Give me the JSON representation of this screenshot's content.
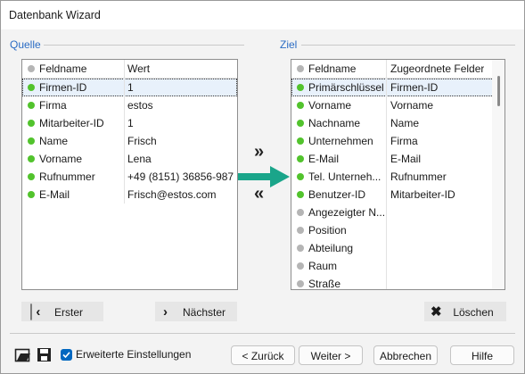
{
  "window": {
    "title": "Datenbank Wizard"
  },
  "source": {
    "label": "Quelle",
    "header": {
      "col1": "Feldname",
      "col2": "Wert"
    },
    "rows": [
      {
        "name": "Firmen-ID",
        "value": "1",
        "status": "green",
        "selected": true
      },
      {
        "name": "Firma",
        "value": "estos",
        "status": "green"
      },
      {
        "name": "Mitarbeiter-ID",
        "value": "1",
        "status": "green"
      },
      {
        "name": "Name",
        "value": "Frisch",
        "status": "green"
      },
      {
        "name": "Vorname",
        "value": "Lena",
        "status": "green"
      },
      {
        "name": "Rufnummer",
        "value": "+49 (8151) 36856-987",
        "status": "green"
      },
      {
        "name": "E-Mail",
        "value": "Frisch@estos.com",
        "status": "green"
      }
    ]
  },
  "target": {
    "label": "Ziel",
    "header": {
      "col1": "Feldname",
      "col2": "Zugeordnete Felder"
    },
    "rows": [
      {
        "name": "Primärschlüssel",
        "value": "Firmen-ID",
        "status": "green",
        "selected": true
      },
      {
        "name": "Vorname",
        "value": "Vorname",
        "status": "green"
      },
      {
        "name": "Nachname",
        "value": "Name",
        "status": "green"
      },
      {
        "name": "Unternehmen",
        "value": "Firma",
        "status": "green"
      },
      {
        "name": "E-Mail",
        "value": "E-Mail",
        "status": "green"
      },
      {
        "name": "Tel. Unterneh...",
        "value": "Rufnummer",
        "status": "green"
      },
      {
        "name": "Benutzer-ID",
        "value": "Mitarbeiter-ID",
        "status": "green"
      },
      {
        "name": "Angezeigter N...",
        "value": "",
        "status": "gray"
      },
      {
        "name": "Position",
        "value": "",
        "status": "gray"
      },
      {
        "name": "Abteilung",
        "value": "",
        "status": "gray"
      },
      {
        "name": "Raum",
        "value": "",
        "status": "gray"
      },
      {
        "name": "Straße",
        "value": "",
        "status": "gray"
      }
    ]
  },
  "buttons": {
    "first": "Erster",
    "next": "Nächster",
    "delete": "Löschen",
    "back": "< Zurück",
    "forward": "Weiter >",
    "cancel": "Abbrechen",
    "help": "Hilfe"
  },
  "options": {
    "advanced_label": "Erweiterte Einstellungen",
    "advanced_checked": true
  },
  "icons": {
    "add_all": "double-chevron-right",
    "remove_all": "double-chevron-left",
    "first": "skip-to-first",
    "next": "chevron-right",
    "delete": "x-mark",
    "open": "folder-open",
    "save": "floppy-disk",
    "map_arrow": "teal-arrow"
  },
  "colors": {
    "accent": "#2b6cc4",
    "mapped": "#52c32d",
    "unmapped": "#b5b5b5",
    "arrow": "#1aa58a",
    "checkbox": "#0067c0"
  }
}
